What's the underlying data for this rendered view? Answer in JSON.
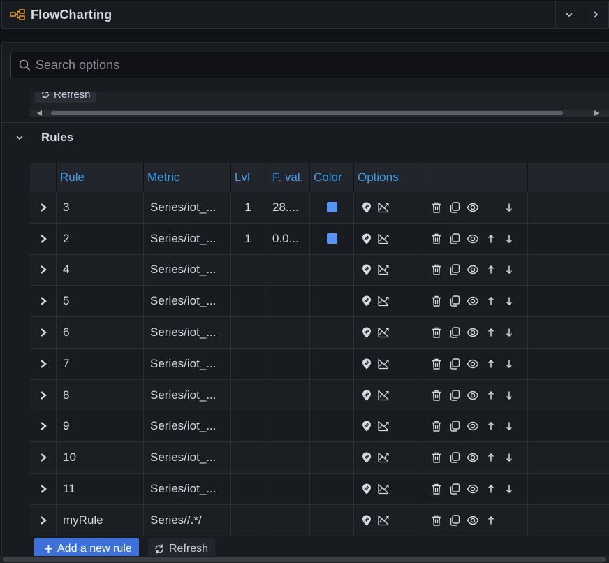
{
  "header": {
    "title": "FlowCharting",
    "logo_icon": "flowchart-logo-icon",
    "collapse_icon": "chevron-down-icon",
    "expand_icon": "chevron-right-icon"
  },
  "search": {
    "placeholder": "Search options",
    "value": ""
  },
  "prev_section": {
    "refresh_label": "Refresh"
  },
  "rules_section": {
    "title": "Rules",
    "columns": [
      "",
      "Rule",
      "Metric",
      "Lvl",
      "F. val.",
      "Color",
      "Options",
      ""
    ],
    "rows": [
      {
        "rule": "3",
        "metric": "Series/iot_...",
        "lvl": "1",
        "fval": "28....",
        "color": "#5794f2",
        "up": false,
        "down": true
      },
      {
        "rule": "2",
        "metric": "Series/iot_...",
        "lvl": "1",
        "fval": "0.0...",
        "color": "#5794f2",
        "up": true,
        "down": true
      },
      {
        "rule": "4",
        "metric": "Series/iot_...",
        "lvl": "",
        "fval": "",
        "color": "",
        "up": true,
        "down": true
      },
      {
        "rule": "5",
        "metric": "Series/iot_...",
        "lvl": "",
        "fval": "",
        "color": "",
        "up": true,
        "down": true
      },
      {
        "rule": "6",
        "metric": "Series/iot_...",
        "lvl": "",
        "fval": "",
        "color": "",
        "up": true,
        "down": true
      },
      {
        "rule": "7",
        "metric": "Series/iot_...",
        "lvl": "",
        "fval": "",
        "color": "",
        "up": true,
        "down": true
      },
      {
        "rule": "8",
        "metric": "Series/iot_...",
        "lvl": "",
        "fval": "",
        "color": "",
        "up": true,
        "down": true
      },
      {
        "rule": "9",
        "metric": "Series/iot_...",
        "lvl": "",
        "fval": "",
        "color": "",
        "up": true,
        "down": true
      },
      {
        "rule": "10",
        "metric": "Series/iot_...",
        "lvl": "",
        "fval": "",
        "color": "",
        "up": true,
        "down": true
      },
      {
        "rule": "11",
        "metric": "Series/iot_...",
        "lvl": "",
        "fval": "",
        "color": "",
        "up": true,
        "down": true
      },
      {
        "rule": "myRule",
        "metric": "Series//.*/",
        "lvl": "",
        "fval": "",
        "color": "",
        "up": true,
        "down": false
      }
    ]
  },
  "buttons": {
    "add_rule": "Add a new rule",
    "refresh": "Refresh"
  },
  "colors": {
    "accent": "#3d71d9",
    "header_text": "#3d9fe8",
    "swatch": "#5794f2"
  }
}
